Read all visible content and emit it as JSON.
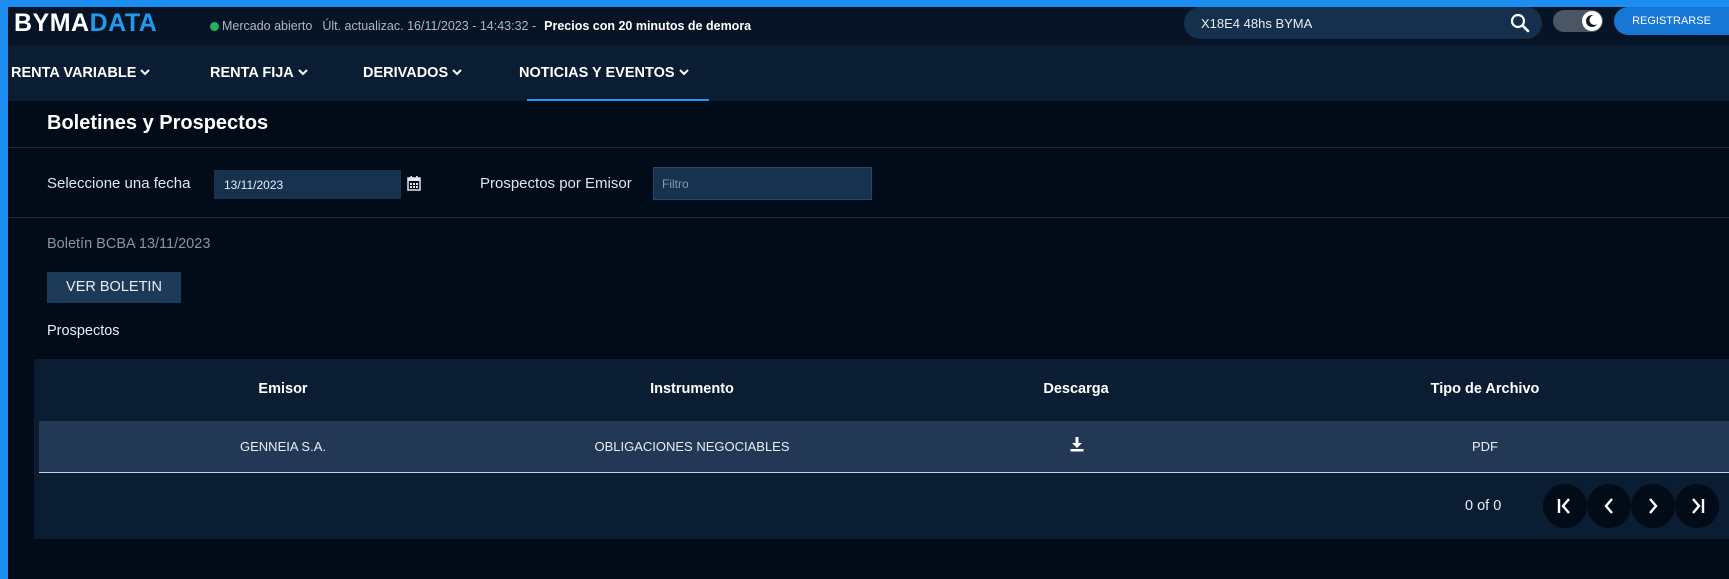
{
  "header": {
    "logo_main": "BYMA",
    "logo_accent": "DATA",
    "market_status": "Mercado abierto",
    "last_update": "Últ. actualizac. 16/11/2023 - 14:43:32 -",
    "delay_notice": "Precios con 20 minutos de demora",
    "search_value": "X18E4 48hs BYMA",
    "register_label": "REGISTRARSE",
    "status_color": "#21b35a",
    "accent_color": "#1e9bf0"
  },
  "nav": {
    "items": [
      {
        "label": "RENTA VARIABLE"
      },
      {
        "label": "RENTA FIJA"
      },
      {
        "label": "DERIVADOS"
      },
      {
        "label": "NOTICIAS Y EVENTOS",
        "active": true
      }
    ]
  },
  "page": {
    "title": "Boletines y Prospectos",
    "date_label": "Seleccione una fecha",
    "date_value": "13/11/2023",
    "issuer_label": "Prospectos por Emisor",
    "filter_placeholder": "Filtro",
    "boletin_text": "Boletín BCBA 13/11/2023",
    "ver_boletin": "VER BOLETIN",
    "prospectos_label": "Prospectos"
  },
  "table": {
    "headers": [
      "Emisor",
      "Instrumento",
      "Descarga",
      "Tipo de Archivo"
    ],
    "rows": [
      {
        "emisor": "GENNEIA S.A.",
        "instrumento": "OBLIGACIONES NEGOCIABLES",
        "descarga": "download-icon",
        "tipo": "PDF"
      }
    ],
    "pagination": "0 of 0"
  }
}
